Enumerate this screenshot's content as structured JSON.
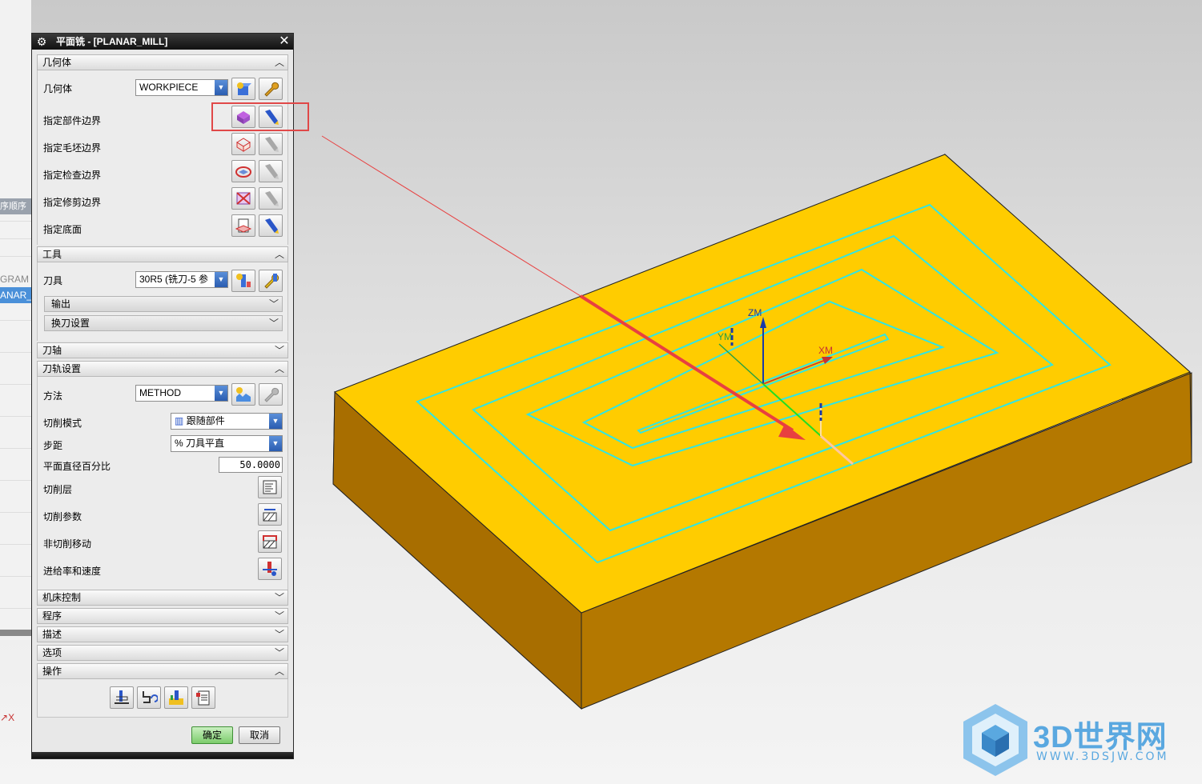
{
  "navigator": {
    "header": "序顺序",
    "rows": [
      "GRAM",
      "ANAR_"
    ],
    "axis_label": "X"
  },
  "dialog": {
    "title": "平面铣 - [PLANAR_MILL]",
    "sections": {
      "geometry": {
        "header": "几何体",
        "geometry_label": "几何体",
        "geometry_value": "WORKPIECE",
        "rows": [
          "指定部件边界",
          "指定毛坯边界",
          "指定检查边界",
          "指定修剪边界",
          "指定底面"
        ]
      },
      "tool": {
        "header": "工具",
        "tool_label": "刀具",
        "tool_value": "30R5 (铣刀-5 参",
        "output_label": "输出",
        "toolchange_label": "换刀设置"
      },
      "axis": {
        "header": "刀轴"
      },
      "path": {
        "header": "刀轨设置",
        "method_label": "方法",
        "method_value": "METHOD",
        "cut_pattern_label": "切削模式",
        "cut_pattern_value": "跟随部件",
        "stepover_label": "步距",
        "stepover_value": "% 刀具平直",
        "percent_label": "平面直径百分比",
        "percent_value": "50.0000",
        "cut_levels_label": "切削层",
        "cut_params_label": "切削参数",
        "non_cut_label": "非切削移动",
        "feeds_label": "进给率和速度"
      },
      "machine": {
        "header": "机床控制"
      },
      "program": {
        "header": "程序"
      },
      "description": {
        "header": "描述"
      },
      "options": {
        "header": "选项"
      },
      "actions": {
        "header": "操作"
      }
    },
    "ok_label": "确定",
    "cancel_label": "取消"
  },
  "viewport": {
    "axis_labels": {
      "zm": "ZM",
      "ym": "YM",
      "xm": "XM"
    },
    "colors": {
      "top": "#ffcc00",
      "front": "#b47800",
      "side": "#d99c00",
      "toolpath": "#2ee6e6",
      "arrow": "#e84040"
    }
  },
  "watermark": {
    "brand": "3D世界网",
    "url": "WWW.3DSJW.COM"
  }
}
